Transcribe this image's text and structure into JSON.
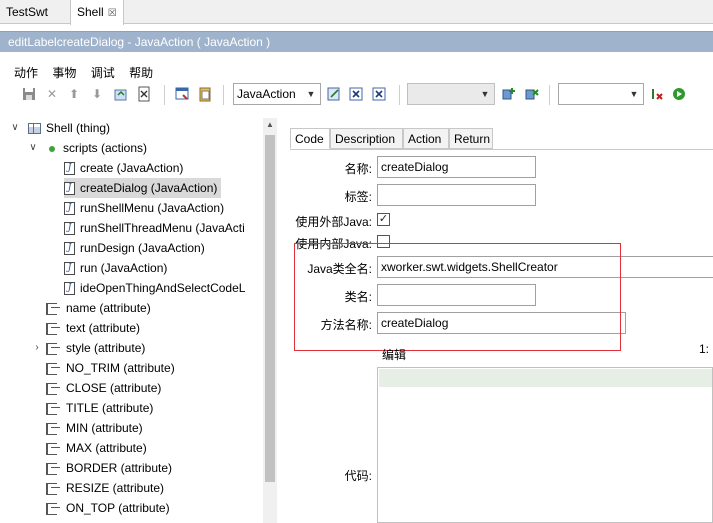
{
  "editor_tabs": [
    {
      "label": "TestSwt"
    },
    {
      "label": "Shell",
      "close": "☒"
    }
  ],
  "window_title": "editLabelcreateDialog - JavaAction ( JavaAction )",
  "menubar": [
    "动作",
    "事物",
    "调试",
    "帮助"
  ],
  "toolbar": {
    "type_combo": "JavaAction",
    "empty_combo": "",
    "empty_combo2": ""
  },
  "tree": {
    "root": "Shell (thing)",
    "scripts": "scripts (actions)",
    "actions": [
      "create (JavaAction)",
      "createDialog (JavaAction)",
      "runShellMenu (JavaAction)",
      "runShellThreadMenu (JavaActi",
      "runDesign (JavaAction)",
      "run (JavaAction)",
      "ideOpenThingAndSelectCodeL"
    ],
    "attributes": [
      "name (attribute)",
      "text (attribute)",
      "style (attribute)",
      "NO_TRIM (attribute)",
      "CLOSE (attribute)",
      "TITLE (attribute)",
      "MIN (attribute)",
      "MAX (attribute)",
      "BORDER (attribute)",
      "RESIZE (attribute)",
      "ON_TOP (attribute)"
    ],
    "selected_index": 1
  },
  "detail_tabs": [
    "Code",
    "Description",
    "Action",
    "Return"
  ],
  "form": {
    "name_label": "名称:",
    "name_value": "createDialog",
    "tag_label": "标签:",
    "tag_value": "",
    "use_outer_java_label": "使用外部Java:",
    "use_outer_java": true,
    "use_inner_java_label": "使用内部Java:",
    "use_inner_java": false,
    "java_class_label": "Java类全名:",
    "java_class_value": "xworker.swt.widgets.ShellCreator",
    "class_label": "类名:",
    "class_value": "",
    "method_label": "方法名称:",
    "method_value": "createDialog",
    "edit_label": "编辑",
    "position": "1:",
    "code_label": "代码:"
  },
  "colors": {
    "title_strip": "#9fb3cc",
    "highlight_box": "#e0303a",
    "selection": "#d9d9d9"
  }
}
